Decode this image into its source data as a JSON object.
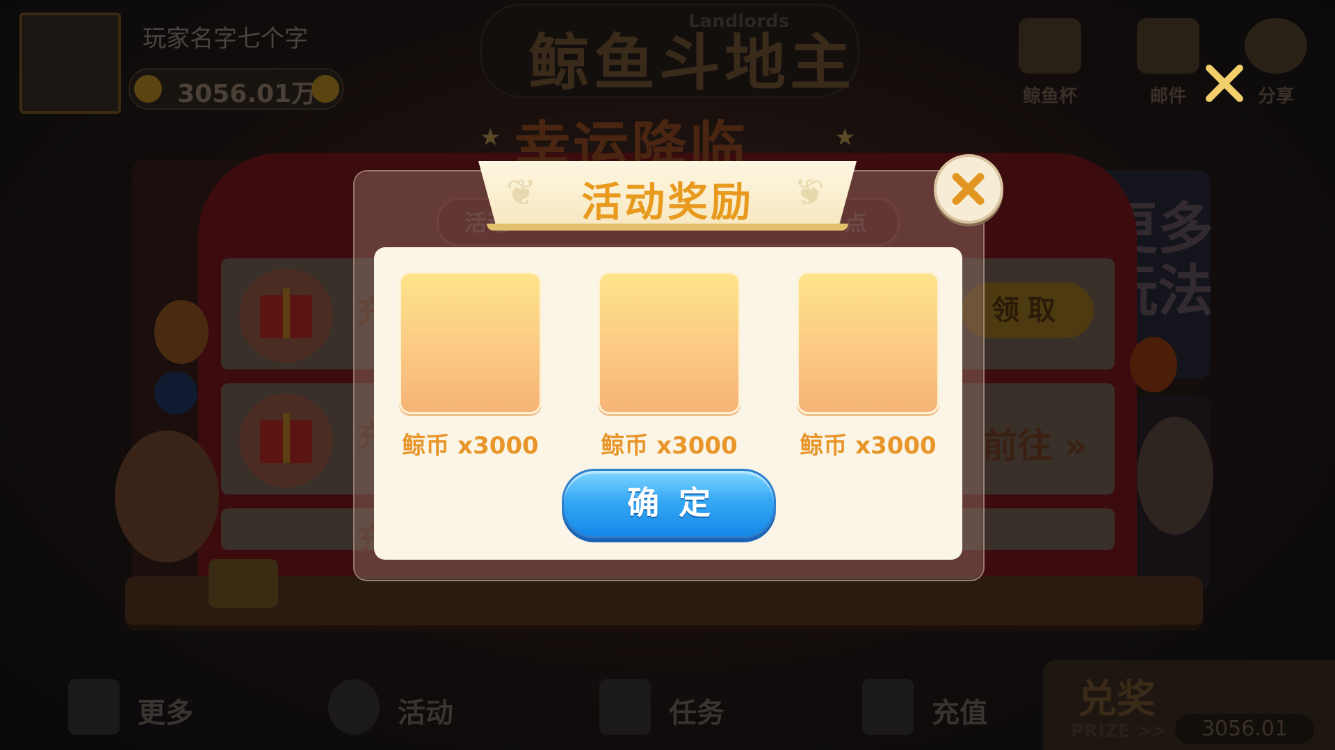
{
  "header": {
    "player_name": "玩家名字七个字",
    "coins": "3056.01万",
    "logo_text": "鲸鱼斗地主",
    "logo_sub": "Landlords",
    "icons": [
      {
        "name": "trophy-icon",
        "label": "鲸鱼杯"
      },
      {
        "name": "mail-icon",
        "label": "邮件"
      },
      {
        "name": "share-icon",
        "label": "分享"
      }
    ]
  },
  "banner": {
    "title": "幸运降临"
  },
  "background_panel": {
    "more_text": "更多\n玩法",
    "rows": [
      {
        "text": "充",
        "button": "领取"
      },
      {
        "text": "充",
        "link": "前往 »"
      },
      {
        "text": "充"
      }
    ]
  },
  "modal": {
    "title": "活动奖励",
    "sub_left": "活动",
    "sub_right": "24点",
    "rewards": [
      {
        "icon": "reward-placeholder",
        "label": "鲸币 x3000"
      },
      {
        "icon": "reward-placeholder",
        "label": "鲸币 x3000"
      },
      {
        "icon": "reward-placeholder",
        "label": "鲸币 x3000"
      }
    ],
    "confirm_label": "确定"
  },
  "bottom_nav": {
    "items": [
      {
        "name": "more",
        "label": "更多"
      },
      {
        "name": "activity",
        "label": "活动"
      },
      {
        "name": "tasks",
        "label": "任务"
      },
      {
        "name": "recharge",
        "label": "充值"
      }
    ],
    "prize": {
      "title": "兑奖",
      "sub": "PRIZE >>",
      "amount": "3056.01"
    }
  },
  "colors": {
    "modal_title": "#e89a1f",
    "reward_label": "#e8962a",
    "confirm_button": "#36a9f4",
    "close_gold": "#f2cf6a"
  }
}
